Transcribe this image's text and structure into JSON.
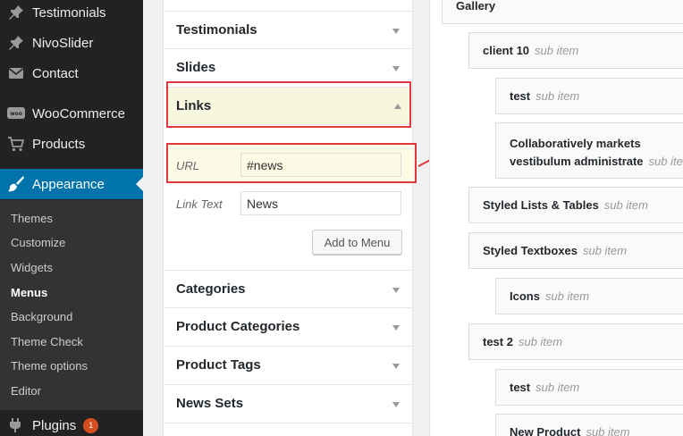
{
  "sidebar": {
    "items": [
      {
        "label": "Testimonials",
        "icon": "pin-icon"
      },
      {
        "label": "NivoSlider",
        "icon": "pin-icon"
      },
      {
        "label": "Contact",
        "icon": "envelope-icon"
      },
      {
        "label": "WooCommerce",
        "icon": "woocommerce-icon"
      },
      {
        "label": "Products",
        "icon": "cart-icon"
      },
      {
        "label": "Appearance",
        "icon": "brush-icon"
      },
      {
        "label": "Plugins",
        "icon": "plug-icon",
        "badge": "1"
      }
    ],
    "submenu": [
      "Themes",
      "Customize",
      "Widgets",
      "Menus",
      "Background",
      "Theme Check",
      "Theme options",
      "Editor"
    ],
    "current_submenu": "Menus",
    "colors": {
      "bg": "#222222",
      "submenu_bg": "#333333",
      "accent": "#0073aa",
      "badge": "#d54e21"
    }
  },
  "accordion": {
    "sections_top": [
      "Testimonials",
      "Slides"
    ],
    "open_section": "Links",
    "url_label": "URL",
    "url_value": "#news",
    "link_text_label": "Link Text",
    "link_text_value": "News",
    "add_button": "Add to Menu",
    "sections_bottom": [
      "Categories",
      "Product Categories",
      "Product Tags",
      "News Sets"
    ]
  },
  "structure": {
    "items": [
      {
        "title": "Gallery",
        "type": ""
      },
      {
        "title": "client 10",
        "type": "sub item"
      },
      {
        "title": "test",
        "type": "sub item"
      },
      {
        "title": "Collaboratively markets vestibulum administrate",
        "type": "sub item"
      },
      {
        "title": "Styled Lists & Tables",
        "type": "sub item"
      },
      {
        "title": "Styled Textboxes",
        "type": "sub item"
      },
      {
        "title": "Icons",
        "type": "sub item"
      },
      {
        "title": "test 2",
        "type": "sub item"
      },
      {
        "title": "test",
        "type": "sub item"
      },
      {
        "title": "New Product",
        "type": "sub item"
      }
    ]
  },
  "annotation_color": "#e0383e"
}
